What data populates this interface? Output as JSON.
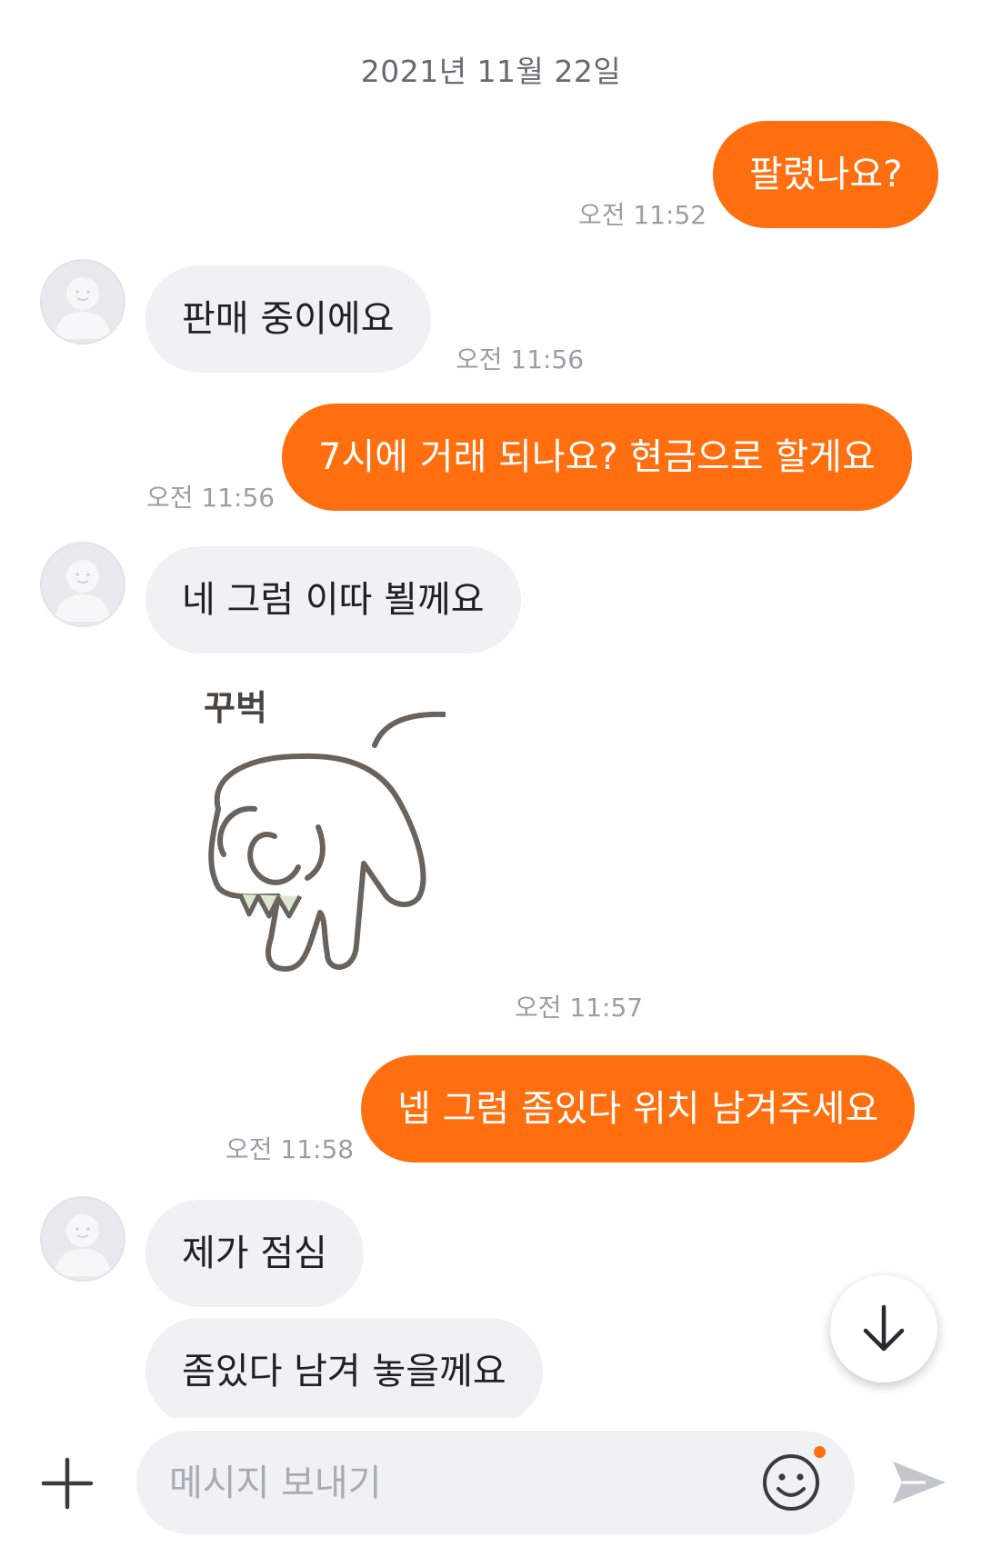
{
  "date_header": "2021년 11월 22일",
  "messages": [
    {
      "side": "mine",
      "text": "팔렸나요?",
      "time": "오전 11:52"
    },
    {
      "side": "theirs",
      "text": "판매 중이에요",
      "time": "오전 11:56"
    },
    {
      "side": "mine",
      "text": "7시에 거래 되나요? 현금으로 할게요",
      "time": "오전 11:56"
    },
    {
      "side": "theirs",
      "text": "네 그럼 이따 뵐께요",
      "time": ""
    },
    {
      "side": "theirs",
      "type": "sticker",
      "sticker_text": "꾸벅",
      "time": "오전 11:57"
    },
    {
      "side": "mine",
      "text": "넵 그럼 좀있다 위치 남겨주세요",
      "time": "오전 11:58"
    },
    {
      "side": "theirs",
      "text": "제가 점심",
      "time": ""
    },
    {
      "side": "theirs",
      "text": "좀있다 남겨 놓을께요",
      "time": ""
    }
  ],
  "input": {
    "placeholder": "메시지 보내기",
    "value": ""
  },
  "icons": {
    "attach": "plus-icon",
    "emoji": "smile-icon",
    "send": "send-icon",
    "scroll": "arrow-down-icon",
    "avatar": "default-profile-icon"
  },
  "colors": {
    "accent": "#ff6f0f",
    "incoming_bubble": "#f0f1f5",
    "timestamp": "#9a9ea6"
  }
}
